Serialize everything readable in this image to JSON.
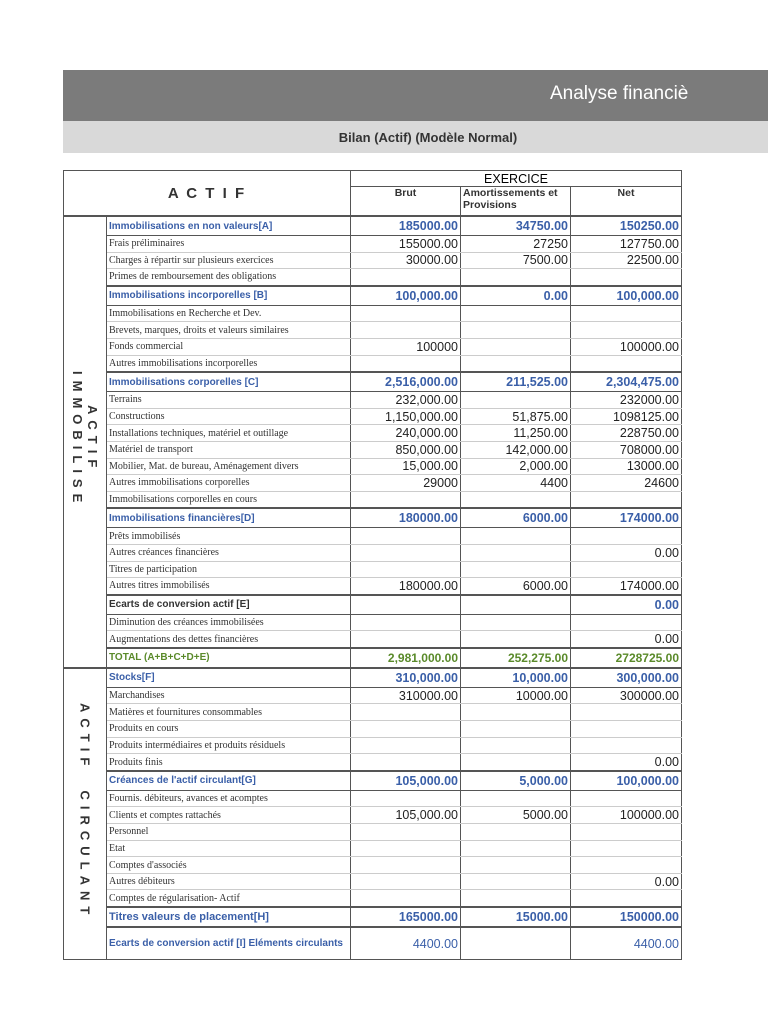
{
  "title": "Analyse financiè",
  "subtitle": "Bilan (Actif) (Modèle Normal)",
  "header": {
    "actif": "A C T I F",
    "exercice": "EXERCICE",
    "brut": "Brut",
    "amort": "Amortissements et Provisions",
    "net": "Net"
  },
  "sections": {
    "immobilise_1": "ACTIF",
    "immobilise_2": "IMMOBILISE",
    "circulant": "ACTIF  CIRCULANT"
  },
  "rows_immobilise": [
    [
      "Immobilisations en non valeurs[A]",
      "185000.00",
      "34750.00",
      "150250.00",
      "g"
    ],
    [
      "Frais préliminaires",
      "155000.00",
      "27250",
      "127750.00",
      "n"
    ],
    [
      "Charges à répartir sur plusieurs exercices",
      "30000.00",
      "7500.00",
      "22500.00",
      "n"
    ],
    [
      "Primes de remboursement des obligations",
      "",
      "",
      "",
      "n"
    ],
    [
      "Immobilisations incorporelles [B]",
      "100,000.00",
      "0.00",
      "100,000.00",
      "g"
    ],
    [
      "Immobilisations en Recherche et Dev.",
      "",
      "",
      "",
      "n"
    ],
    [
      "Brevets, marques, droits et valeurs similaires",
      "",
      "",
      "",
      "n"
    ],
    [
      "Fonds commercial",
      "100000",
      "",
      "100000.00",
      "n"
    ],
    [
      "Autres immobilisations incorporelles",
      "",
      "",
      "",
      "n"
    ],
    [
      "Immobilisations corporelles [C]",
      "2,516,000.00",
      "211,525.00",
      "2,304,475.00",
      "g"
    ],
    [
      "Terrains",
      "232,000.00",
      "",
      "232000.00",
      "n"
    ],
    [
      "Constructions",
      "1,150,000.00",
      "51,875.00",
      "1098125.00",
      "n"
    ],
    [
      "Installations techniques, matériel et outillage",
      "240,000.00",
      "11,250.00",
      "228750.00",
      "n"
    ],
    [
      "Matériel de transport",
      "850,000.00",
      "142,000.00",
      "708000.00",
      "n"
    ],
    [
      "Mobilier, Mat. de bureau, Aménagement divers",
      "15,000.00",
      "2,000.00",
      "13000.00",
      "n"
    ],
    [
      "Autres immobilisations corporelles",
      "29000",
      "4400",
      "24600",
      "n"
    ],
    [
      "Immobilisations corporelles en cours",
      "",
      "",
      "",
      "n"
    ],
    [
      "Immobilisations financières[D]",
      "180000.00",
      "6000.00",
      "174000.00",
      "g"
    ],
    [
      "Prêts immobilisés",
      "",
      "",
      "",
      "n"
    ],
    [
      "Autres créances financières",
      "",
      "",
      "0.00",
      "n"
    ],
    [
      "Titres de participation",
      "",
      "",
      "",
      "n"
    ],
    [
      "Autres titres immobilisés",
      "180000.00",
      "6000.00",
      "174000.00",
      "n"
    ],
    [
      "Ecarts de conversion actif [E]",
      "",
      "",
      "0.00",
      "g b"
    ],
    [
      "Diminution des créances immobilisées",
      "",
      "",
      "",
      "n"
    ],
    [
      "Augmentations des dettes financières",
      "",
      "",
      "0.00",
      "n"
    ],
    [
      "TOTAL (A+B+C+D+E)",
      "2,981,000.00",
      "252,275.00",
      "2728725.00",
      "t"
    ]
  ],
  "rows_circulant": [
    [
      "Stocks[F]",
      "310,000.00",
      "10,000.00",
      "300,000.00",
      "g"
    ],
    [
      "Marchandises",
      "310000.00",
      "10000.00",
      "300000.00",
      "n"
    ],
    [
      "Matières et fournitures consommables",
      "",
      "",
      "",
      "n"
    ],
    [
      "Produits en cours",
      "",
      "",
      "",
      "n"
    ],
    [
      "Produits intermédiaires et produits résiduels",
      "",
      "",
      "",
      "n"
    ],
    [
      "Produits finis",
      "",
      "",
      "0.00",
      "n"
    ],
    [
      "Créances de l'actif circulant[G]",
      "105,000.00",
      "5,000.00",
      "100,000.00",
      "g"
    ],
    [
      "Fournis. débiteurs, avances et acomptes",
      "",
      "",
      "",
      "n"
    ],
    [
      "Clients et comptes rattachés",
      "105,000.00",
      "5000.00",
      "100000.00",
      "n"
    ],
    [
      "Personnel",
      "",
      "",
      "",
      "n"
    ],
    [
      "Etat",
      "",
      "",
      "",
      "n"
    ],
    [
      "Comptes d'associés",
      "",
      "",
      "",
      "n"
    ],
    [
      "Autres débiteurs",
      "",
      "",
      "0.00",
      "n"
    ],
    [
      "Comptes de régularisation- Actif",
      "",
      "",
      "",
      "n"
    ],
    [
      "Titres valeurs de placement[H]",
      "165000.00",
      "15000.00",
      "150000.00",
      "g h"
    ],
    [
      "Ecarts de conversion actif [I] Eléments circulants",
      "4400.00",
      "",
      "4400.00",
      "g l"
    ]
  ]
}
